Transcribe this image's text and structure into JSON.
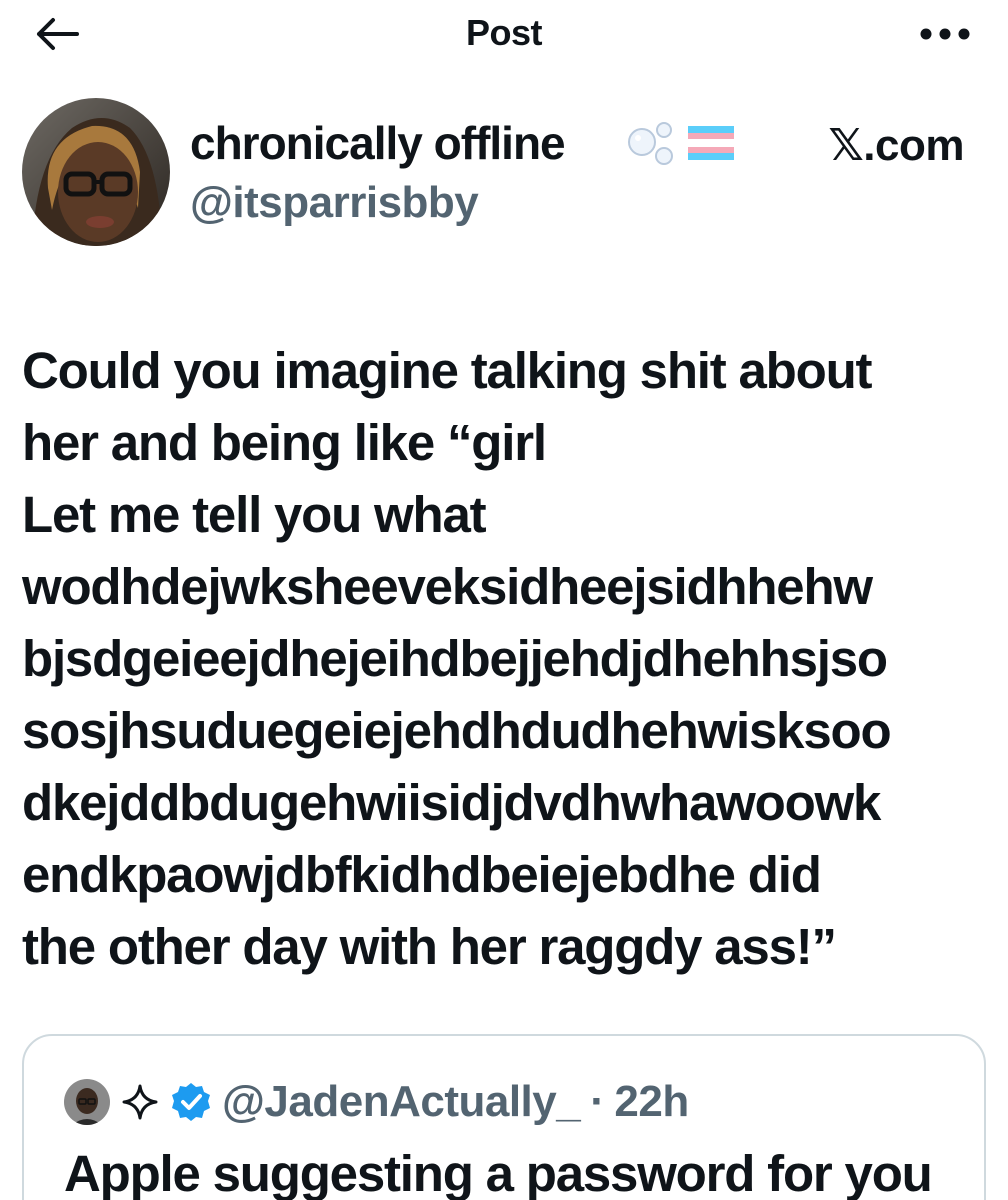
{
  "header": {
    "title": "Post",
    "back_icon": "arrow-left-icon",
    "more_icon": "more-horizontal-icon"
  },
  "author": {
    "display_name": "chronically offline",
    "name_emojis": [
      "bubbles-emoji",
      "transgender-flag-emoji"
    ],
    "handle": "@itsparrisbby",
    "source": "𝕏.com"
  },
  "post": {
    "lines": [
      "Could you imagine talking shit about",
      "her and being like “girl",
      "Let me tell you what",
      "wodhdejwksheeveksidheejsidhhehw",
      "bjsdgeieejdhejeihdbejjehdjdhehhsjso",
      "sosjhsuduegeiejehdhdudhehwisksoo",
      "dkejddbdugehwiisidjdvdhwhawoowk",
      "endkpaowjdbfkidhdbeiejebdhe did",
      "the other day with her raggdy ass!”"
    ]
  },
  "quote": {
    "handle": "@JadenActually_",
    "separator": "·",
    "time": "22h",
    "text": "Apple suggesting a password for you",
    "icons": [
      "sparkle-icon",
      "verified-badge-icon"
    ]
  },
  "colors": {
    "text": "#0f1419",
    "secondary": "#536471",
    "verified": "#1d9bf0",
    "border": "#cfd9de",
    "flag_blue": "#5bcefa",
    "flag_pink": "#f5a9b8"
  }
}
